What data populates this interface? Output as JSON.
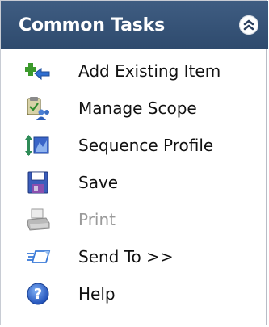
{
  "header": {
    "title": "Common Tasks",
    "collapse_icon": "double-chevron-up-icon"
  },
  "items": [
    {
      "label": "Add Existing Item",
      "icon": "add-existing-item-icon",
      "enabled": true
    },
    {
      "label": "Manage Scope",
      "icon": "manage-scope-icon",
      "enabled": true
    },
    {
      "label": "Sequence Profile",
      "icon": "sequence-profile-icon",
      "enabled": true
    },
    {
      "label": "Save",
      "icon": "save-floppy-icon",
      "enabled": true
    },
    {
      "label": "Print",
      "icon": "printer-icon",
      "enabled": false
    },
    {
      "label": "Send To >>",
      "icon": "send-to-icon",
      "enabled": true
    },
    {
      "label": "Help",
      "icon": "help-icon",
      "enabled": true
    }
  ],
  "colors": {
    "header_bg": "#34527a",
    "header_text": "#ffffff",
    "disabled_text": "#9a9a9a"
  }
}
